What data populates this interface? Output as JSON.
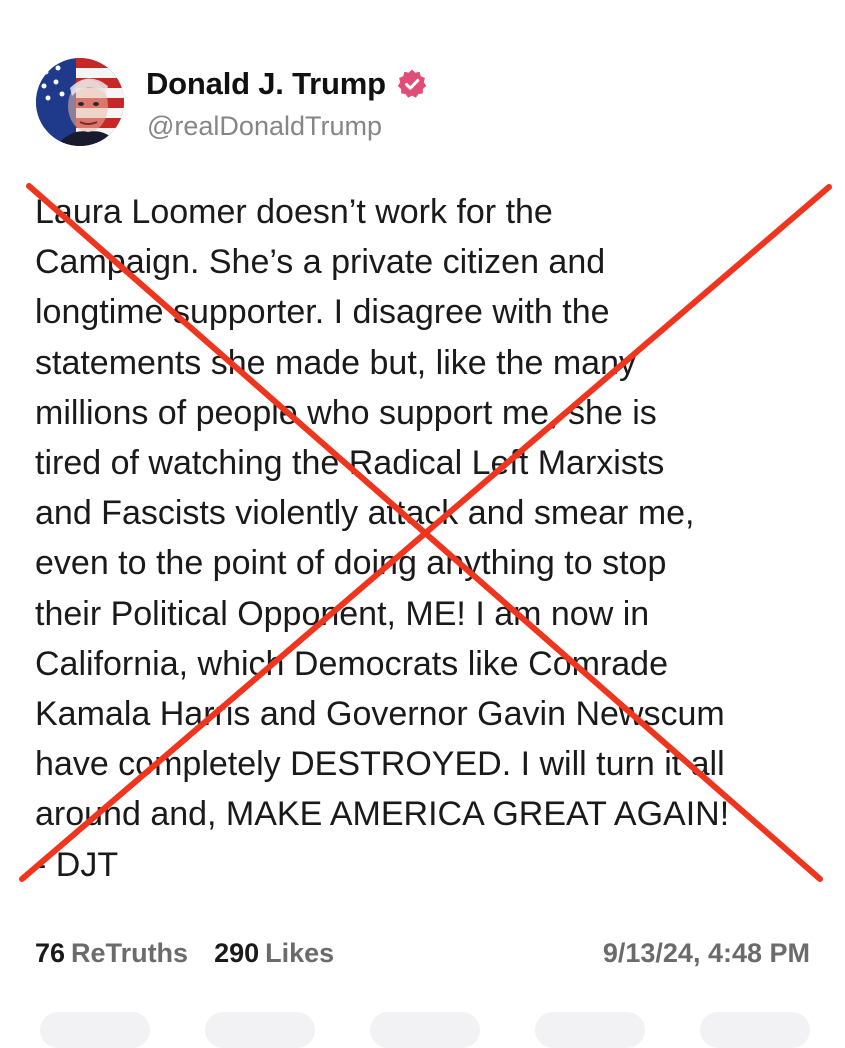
{
  "profile": {
    "display_name": "Donald J. Trump",
    "handle": "@realDonaldTrump",
    "verified_badge_color": "#e04e78",
    "avatar_icon": "flag-portrait-avatar"
  },
  "post": {
    "text": "Laura Loomer doesn’t work for the\nCampaign. She’s a private citizen and\nlongtime supporter. I disagree with the\nstatements she made but, like the many\nmillions of people who support me, she is\ntired of watching the Radical Left Marxists\nand Fascists violently attack and smear me,\neven to the point of doing anything to stop\ntheir Political Opponent, ME! I am now in\nCalifornia, which Democrats like Comrade\nKamala Harris and Governor Gavin Newscum\nhave completely DESTROYED. I will turn it all\naround and, MAKE AMERICA GREAT AGAIN!\n- DJT",
    "cross_out_color": "#f0351f"
  },
  "stats": {
    "retruths_count": "76",
    "retruths_label": "ReTruths",
    "likes_count": "290",
    "likes_label": "Likes",
    "timestamp": "9/13/24, 4:48 PM"
  },
  "actions": [
    {
      "name": "reply-button"
    },
    {
      "name": "retruth-button"
    },
    {
      "name": "like-button"
    },
    {
      "name": "share-button"
    },
    {
      "name": "more-button"
    }
  ]
}
